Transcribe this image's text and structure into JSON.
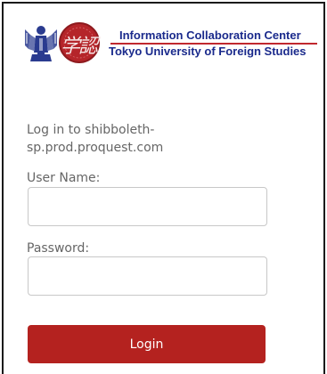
{
  "header": {
    "org_line1": "Information Collaboration Center",
    "org_line2": "Tokyo University of Foreign Studies",
    "seal_glyphs": "学認"
  },
  "login": {
    "heading": "Log in to shibboleth-sp.prod.proquest.com",
    "username_label": "User Name:",
    "username_value": "",
    "password_label": "Password:",
    "password_value": "",
    "submit_label": "Login"
  },
  "colors": {
    "brand_red": "#b4221f",
    "org_blue": "#1a2a8c",
    "rule_red": "#c0282e",
    "label_gray": "#666666"
  },
  "icons": {
    "figure": "university-emblem-icon",
    "seal": "gakunin-seal-icon"
  }
}
